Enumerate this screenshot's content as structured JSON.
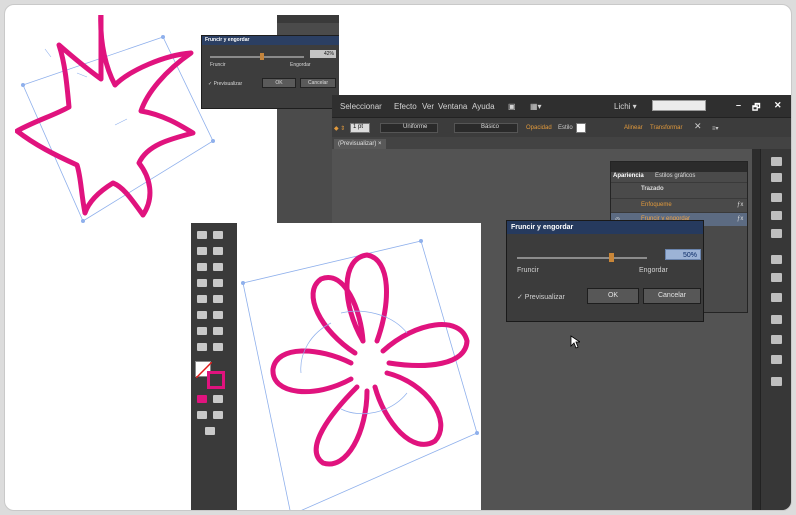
{
  "small_dialog": {
    "title": "Fruncir y engordar",
    "value": "42%",
    "left_label": "Fruncir",
    "right_label": "Engordar",
    "preview": "✓ Previsualizar",
    "ok": "OK",
    "cancel": "Cancelar"
  },
  "menu": {
    "items": [
      "Seleccionar",
      "Efecto",
      "Ver",
      "Ventana",
      "Ayuda"
    ],
    "workspace": "Lichi ▾",
    "window_controls": [
      "–",
      "🗗",
      "✕"
    ]
  },
  "control_bar": {
    "stroke_size": "1 pt",
    "profile": "Uniforme",
    "brush": "Básico",
    "opacity": "Opacidad",
    "style": "Estilo",
    "align": "Alinear",
    "transform": "Transformar"
  },
  "doc_tab": "(Previsualizar) ×",
  "appearance": {
    "tabs": [
      "Apariencia",
      "Estilos gráficos"
    ],
    "rows": [
      "Trazado",
      "Enfoqueme",
      "Fruncir y engordar"
    ]
  },
  "big_dialog": {
    "title": "Fruncir y engordar",
    "value": "50%",
    "left_label": "Fruncir",
    "right_label": "Engordar",
    "preview": "✓ Previsualizar",
    "ok": "OK",
    "cancel": "Cancelar"
  },
  "colors": {
    "shape_stroke": "#e0137e",
    "bbox": "#7fa3e6",
    "dialog_title": "#263a5e"
  }
}
